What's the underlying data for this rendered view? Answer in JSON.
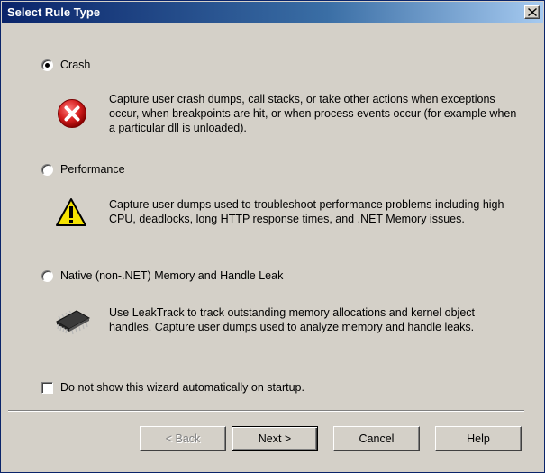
{
  "window": {
    "title": "Select Rule Type"
  },
  "options": [
    {
      "label": "Crash",
      "selected": true,
      "icon": "error-icon",
      "description": "Capture user crash dumps, call stacks, or take other actions when exceptions occur, when breakpoints are hit, or when process events occur (for example when a particular dll is unloaded)."
    },
    {
      "label": "Performance",
      "selected": false,
      "icon": "warning-icon",
      "description": "Capture user dumps used to troubleshoot performance problems including high CPU, deadlocks, long HTTP response times, and .NET Memory issues."
    },
    {
      "label": "Native (non-.NET) Memory and Handle Leak",
      "selected": false,
      "icon": "memory-chip-icon",
      "description": "Use LeakTrack to track outstanding memory allocations and kernel object handles. Capture user dumps used to analyze memory and handle leaks."
    }
  ],
  "startup_checkbox": {
    "label": "Do not show this wizard automatically on startup.",
    "checked": false
  },
  "buttons": {
    "back": "< Back",
    "next": "Next >",
    "cancel": "Cancel",
    "help": "Help"
  },
  "colors": {
    "title_bar": "#0a246a",
    "dialog_bg": "#d4d0c8",
    "error_red": "#d41e1e",
    "warning_yellow": "#f5e200"
  }
}
